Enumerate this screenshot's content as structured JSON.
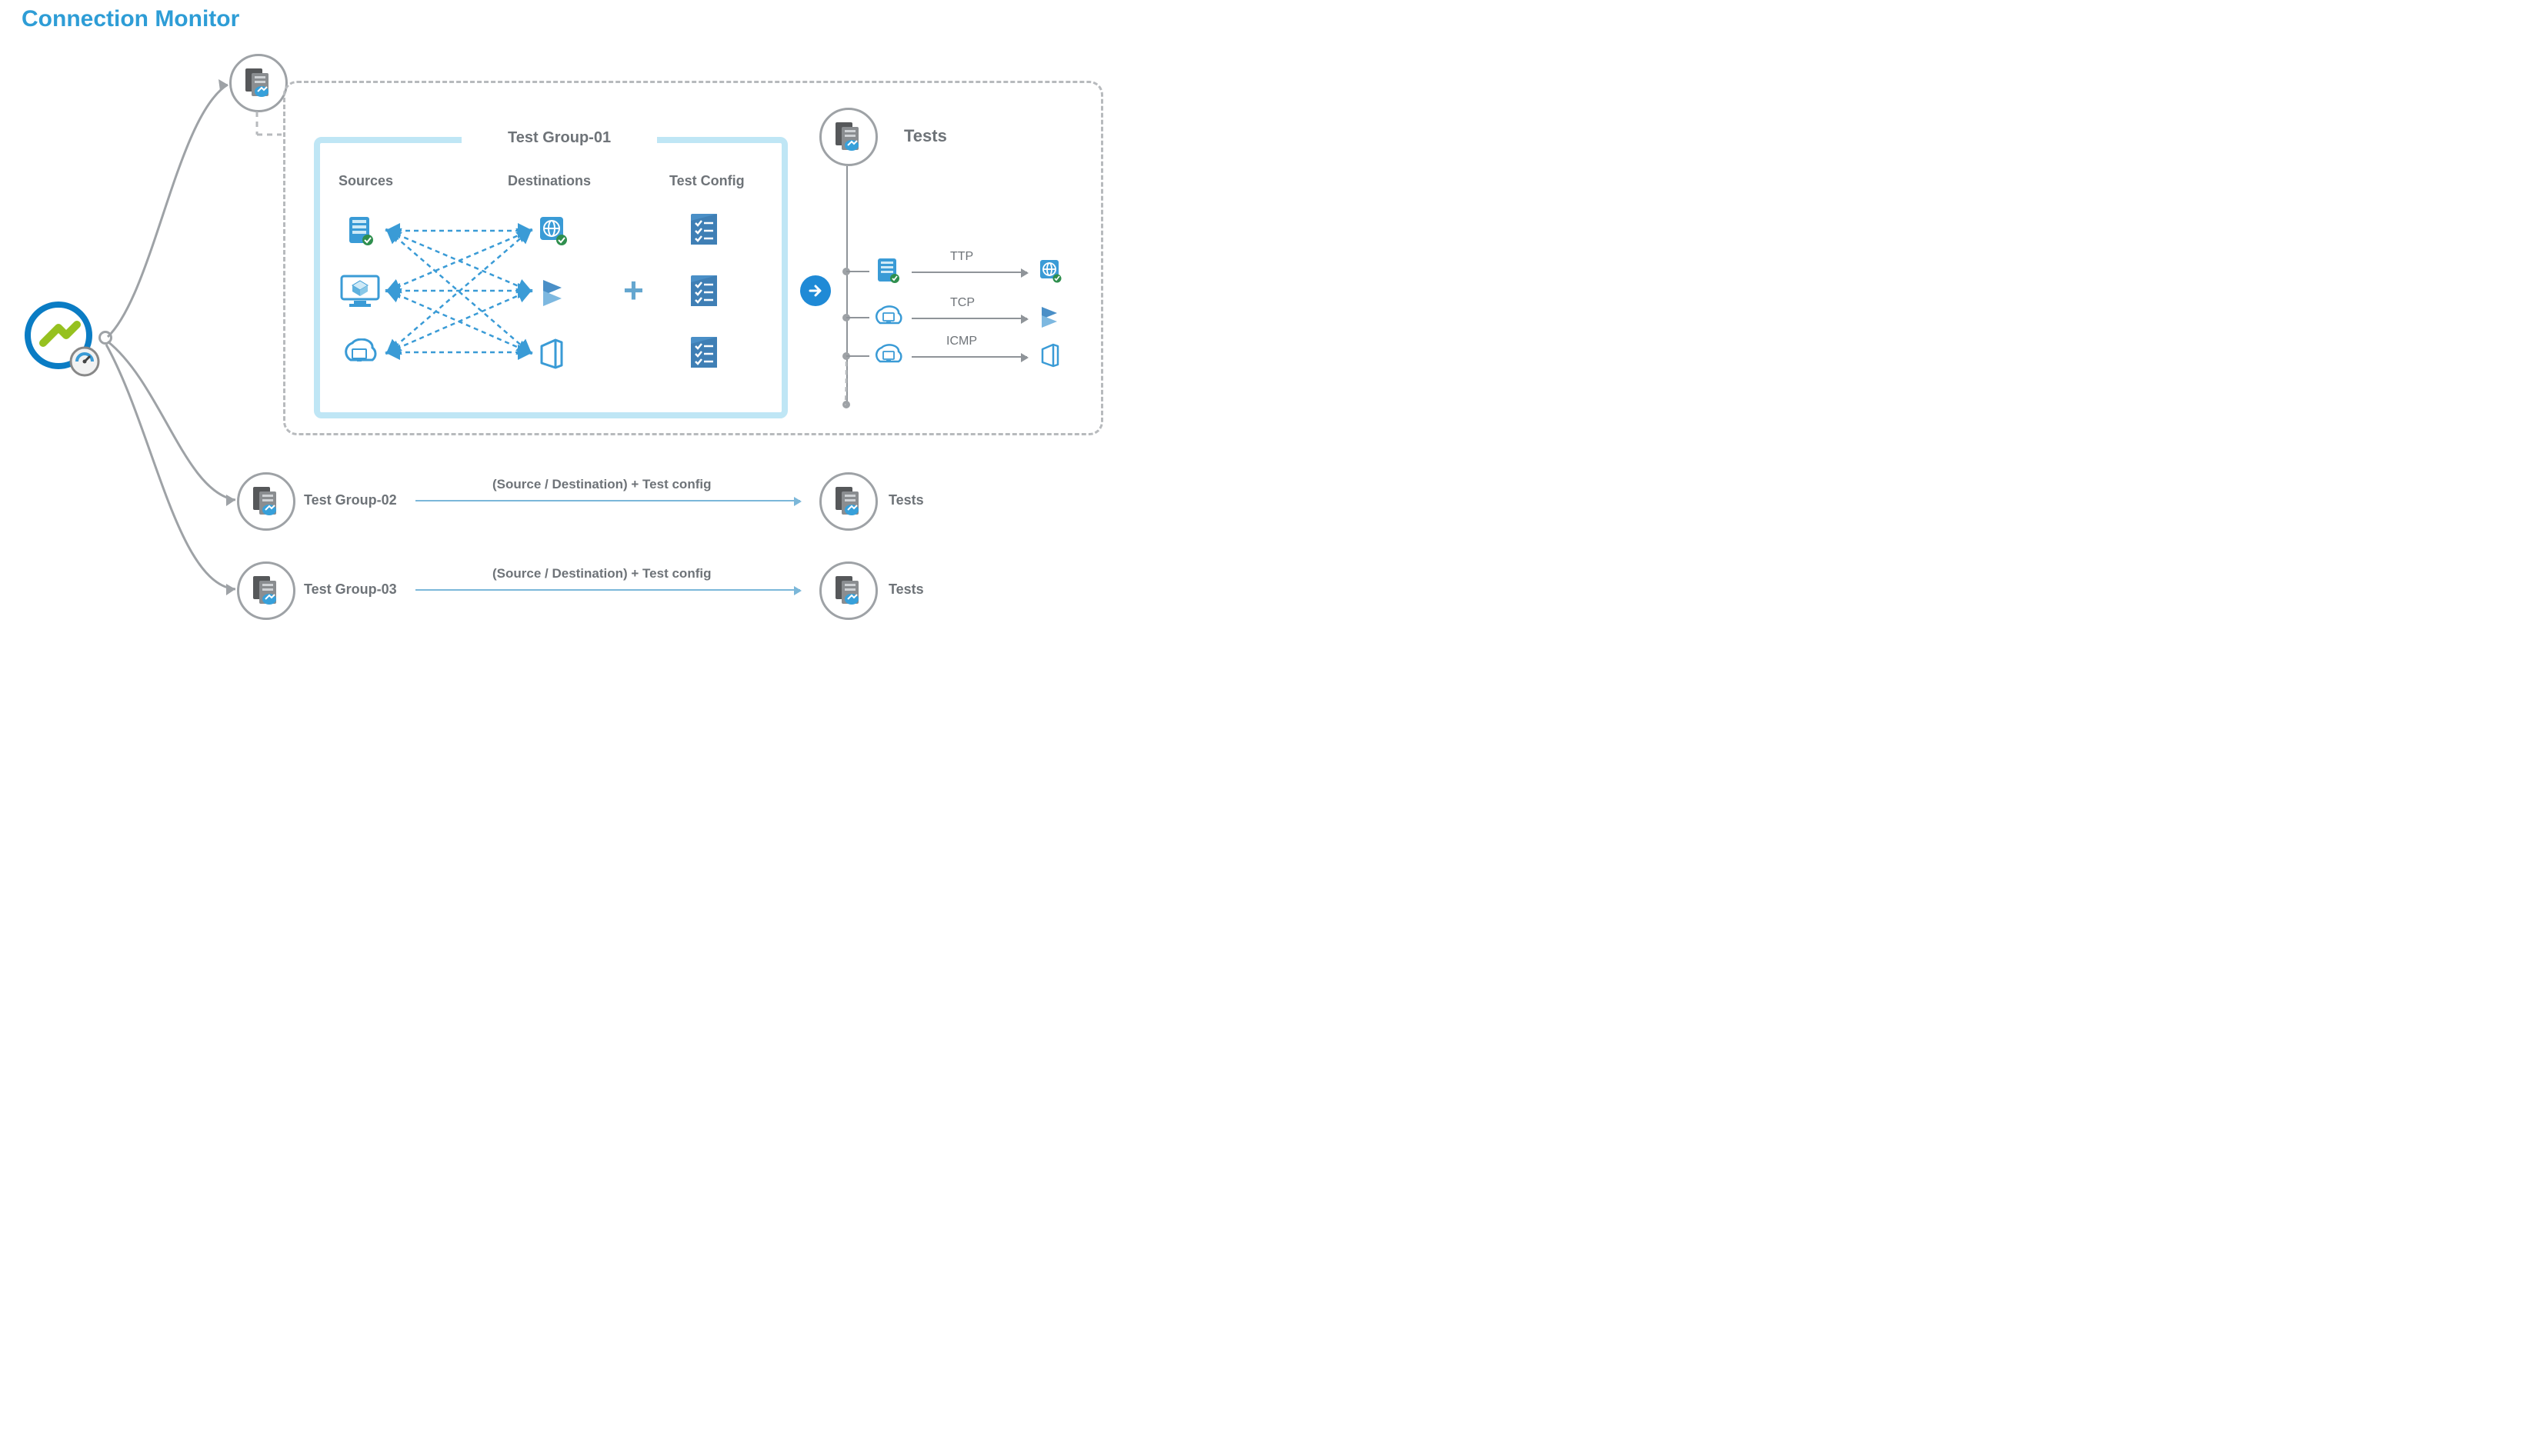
{
  "title": "Connection Monitor",
  "testGroup1": {
    "title": "Test Group-01",
    "columns": {
      "sources": "Sources",
      "destinations": "Destinations",
      "testConfig": "Test Config"
    }
  },
  "testsLabel": "Tests",
  "protocols": {
    "p1": "TTP",
    "p2": "TCP",
    "p3": "ICMP"
  },
  "rows": {
    "tg2": {
      "label": "Test Group-02",
      "arrowText": "(Source / Destination) + Test config",
      "rightLabel": "Tests"
    },
    "tg3": {
      "label": "Test Group-03",
      "arrowText": "(Source / Destination) + Test config",
      "rightLabel": "Tests"
    }
  }
}
